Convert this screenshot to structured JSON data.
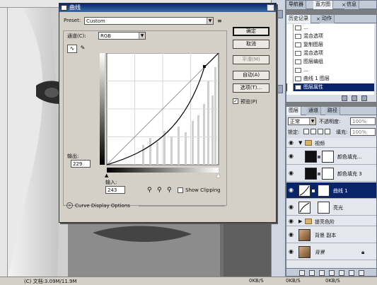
{
  "curves_dialog": {
    "title": "曲线",
    "close": "×",
    "preset_label": "Preset:",
    "preset_value": "Custom",
    "channel_label": "通道(C):",
    "channel_value": "RGB",
    "buttons": {
      "ok": "确定",
      "cancel": "取消",
      "smooth": "平滑(M)",
      "auto": "自动(A)",
      "options": "选项(T)..."
    },
    "preview_label": "预览(P)",
    "output_label": "输出:",
    "output_value": "229",
    "input_label": "输入:",
    "input_value": "243",
    "show_clipping": "Show Clipping",
    "curve_display_options": "Curve Display Options"
  },
  "navigator_tabs": [
    "导航器",
    "直方图",
    "信息"
  ],
  "navigator_close": "×",
  "history_tabs": [
    "历史记录",
    "动作"
  ],
  "history_close": "×",
  "history_items": [
    "…",
    "混合选项",
    "复制图层",
    "混合选项",
    "图层编组",
    "…",
    "曲线 1 图层",
    "图层属性"
  ],
  "layers_tabs": [
    "图层",
    "通道",
    "路径"
  ],
  "layers": {
    "blend_mode": "正常",
    "opacity_label": "不透明度:",
    "opacity_value": "100%",
    "lock_label": "锁定:",
    "fill_label": "填充:",
    "fill_value": "100%",
    "rows": [
      {
        "name": "视频"
      },
      {
        "name": "颜色填充..."
      },
      {
        "name": "颜色填充 3"
      },
      {
        "name": "曲线 1"
      },
      {
        "name": "亮光"
      },
      {
        "name": "提亮色阶"
      },
      {
        "name": "背景 副本"
      },
      {
        "name": "背景"
      }
    ]
  },
  "status": {
    "doc_info": "(C)  文档:3.09M/11.9M",
    "zoom_a": "0KB/S",
    "zoom_b": "0KB/S",
    "zoom_c": "0KB/S"
  },
  "watermark": "…"
}
